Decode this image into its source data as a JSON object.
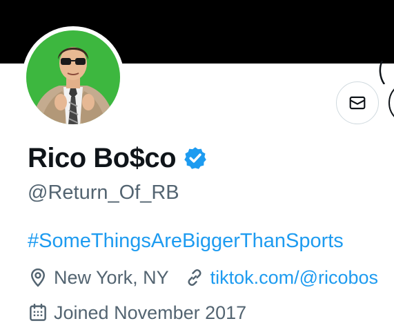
{
  "profile": {
    "display_name": "Rico Bo$co",
    "handle": "@Return_Of_RB",
    "bio": "#SomeThingsAreBiggerThanSports",
    "location": "New York, NY",
    "website": "tiktok.com/@ricobos",
    "joined": "Joined November 2017",
    "verified": true
  },
  "icons": {
    "message": "envelope-icon",
    "verified": "verified-badge-icon",
    "location": "location-pin-icon",
    "website": "link-icon",
    "joined": "calendar-icon"
  },
  "colors": {
    "banner": "#000000",
    "name": "#0f1419",
    "secondary_text": "#536471",
    "link": "#1d9bf0",
    "verified": "#1d9bf0",
    "avatar_backdrop": "#35b23a"
  }
}
